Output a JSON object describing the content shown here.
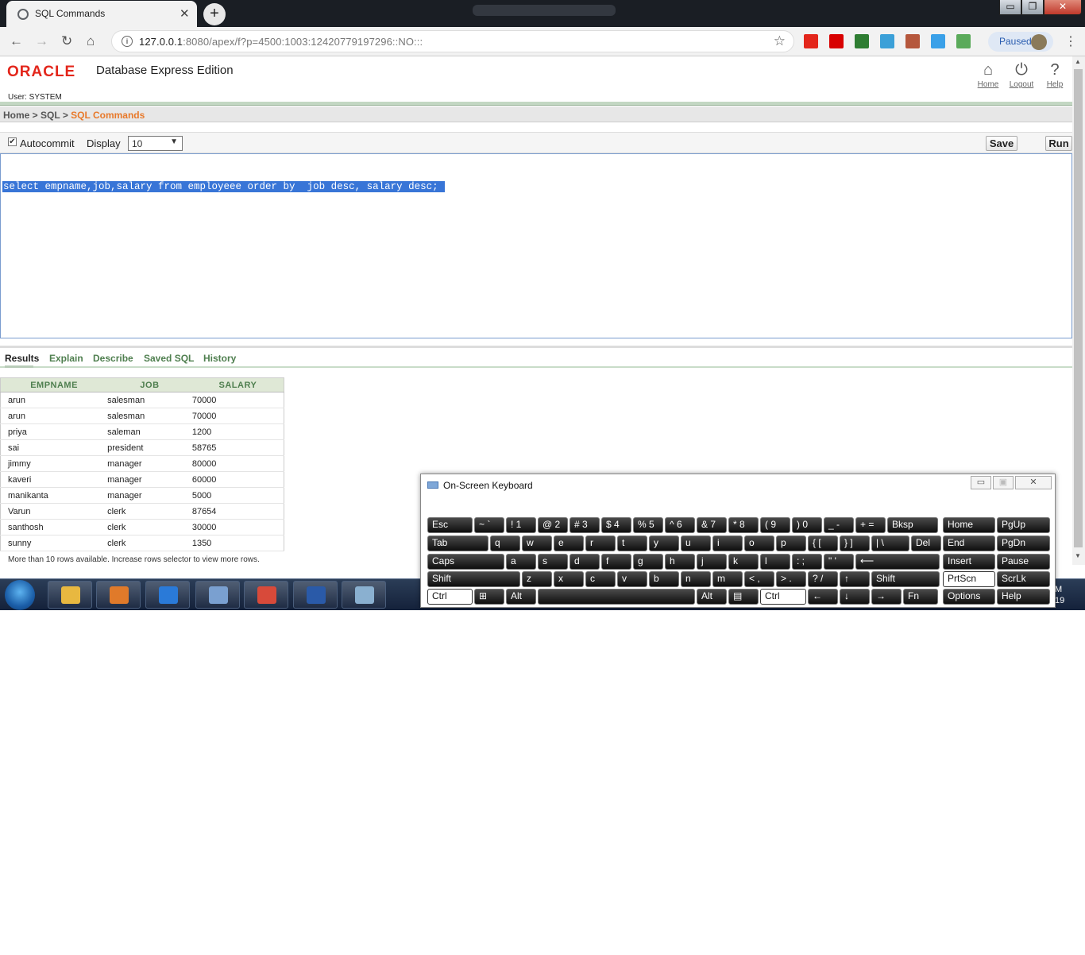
{
  "browser": {
    "tab_title": "SQL Commands",
    "tab_close": "✕",
    "new_tab": "+",
    "url_host": "127.0.0.1",
    "url_rest": ":8080/apex/f?p=4500:1003:12420779197296::NO:::",
    "profile_status": "Paused",
    "window_controls": {
      "minimize": "▭",
      "maximize": "❐",
      "close": "✕"
    },
    "nav": {
      "back": "←",
      "forward": "→",
      "reload": "↻",
      "home": "⌂",
      "star": "☆",
      "menu": "⋮",
      "info": "i"
    },
    "extension_colors": [
      "#e3261b",
      "#d80000",
      "#2e7d32",
      "#3ba0d8",
      "#b5573c",
      "#3aa0e8",
      "#5aaa5a"
    ]
  },
  "header": {
    "logo": "ORACLE",
    "product": "Database Express Edition",
    "user_line": "User: SYSTEM",
    "links": [
      {
        "label": "Home",
        "icon": "⌂"
      },
      {
        "label": "Logout",
        "icon": "⏻"
      },
      {
        "label": "Help",
        "icon": "?"
      }
    ]
  },
  "breadcrumb": {
    "home": "Home",
    "sql": "SQL",
    "current": "SQL Commands",
    "sep": " > "
  },
  "command_bar": {
    "autocommit_label": "Autocommit",
    "autocommit_checked": true,
    "display_label": "Display",
    "display_value": "10",
    "save_label": "Save",
    "run_label": "Run"
  },
  "editor": {
    "sql": "select empname,job,salary from employeee order by  job desc, salary desc;"
  },
  "result_tabs": [
    "Results",
    "Explain",
    "Describe",
    "Saved SQL",
    "History"
  ],
  "results": {
    "columns": [
      "EMPNAME",
      "JOB",
      "SALARY"
    ],
    "rows": [
      [
        "arun",
        "salesman",
        "70000"
      ],
      [
        "arun",
        "salesman",
        "70000"
      ],
      [
        "priya",
        "saleman",
        "1200"
      ],
      [
        "sai",
        "president",
        "58765"
      ],
      [
        "jimmy",
        "manager",
        "80000"
      ],
      [
        "kaveri",
        "manager",
        "60000"
      ],
      [
        "manikanta",
        "manager",
        "5000"
      ],
      [
        "Varun",
        "clerk",
        "87654"
      ],
      [
        "santhosh",
        "clerk",
        "30000"
      ],
      [
        "sunny",
        "clerk",
        "1350"
      ]
    ],
    "more_message": "More than 10 rows available. Increase rows selector to view more rows."
  },
  "osk": {
    "title": "On-Screen Keyboard",
    "controls": {
      "minimize": "▭",
      "restore": "▣",
      "close": "✕"
    },
    "rows": [
      [
        "Esc",
        "~ `",
        "! 1",
        "@ 2",
        "# 3",
        "$ 4",
        "% 5",
        "^ 6",
        "& 7",
        "* 8",
        "( 9",
        ") 0",
        "_ -",
        "+ =",
        "Bksp",
        "Home",
        "PgUp"
      ],
      [
        "Tab",
        "q",
        "w",
        "e",
        "r",
        "t",
        "y",
        "u",
        "i",
        "o",
        "p",
        "{ [",
        "} ]",
        "| \\",
        "Del",
        "End",
        "PgDn"
      ],
      [
        "Caps",
        "a",
        "s",
        "d",
        "f",
        "g",
        "h",
        "j",
        "k",
        "l",
        ": ;",
        "\" '",
        "⟵",
        "Insert",
        "Pause"
      ],
      [
        "Shift",
        "z",
        "x",
        "c",
        "v",
        "b",
        "n",
        "m",
        "< ,",
        "> .",
        "? /",
        "↑",
        "Shift",
        "PrtScn",
        "ScrLk"
      ],
      [
        "Ctrl",
        "⊞",
        "Alt",
        "",
        "Alt",
        "▤",
        "Ctrl",
        "←",
        "↓",
        "→",
        "Fn",
        "Options",
        "Help"
      ]
    ]
  },
  "taskbar": {
    "clock_line1": "M",
    "clock_line2": "19",
    "app_colors": [
      "#e8b840",
      "#e07a2a",
      "#2a7ad8",
      "#7aa0d0",
      "#d84a3a",
      "#2a5aa8",
      "#8ab0d0"
    ]
  }
}
